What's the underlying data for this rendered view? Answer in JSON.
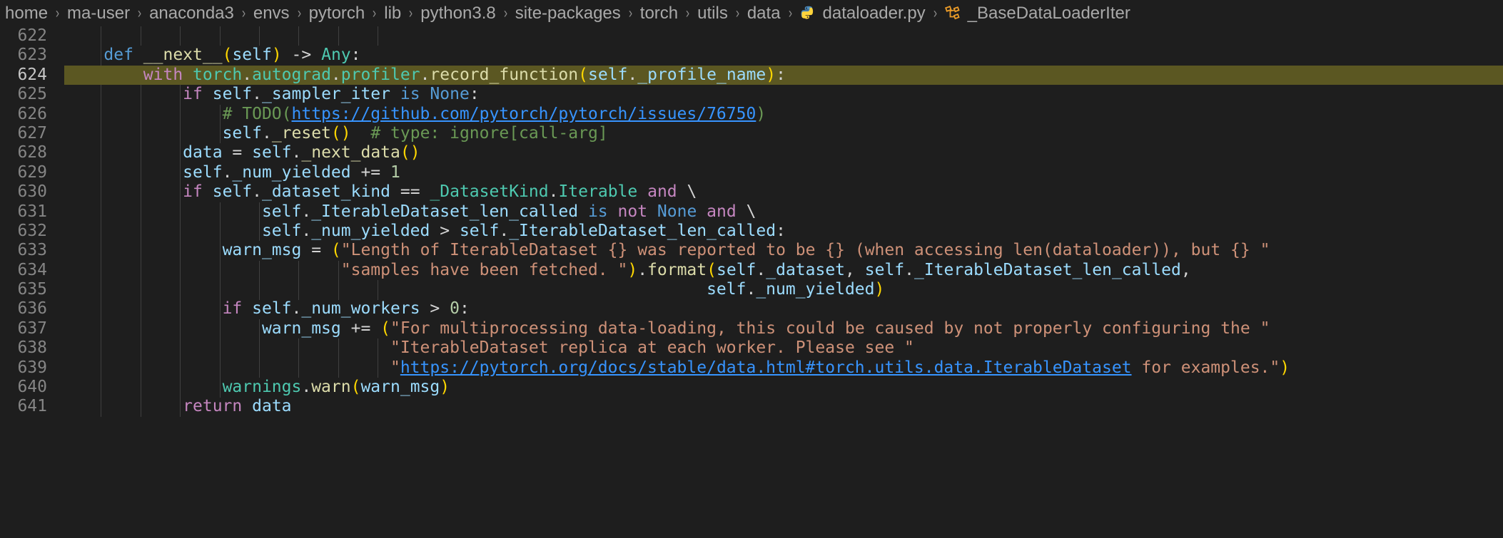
{
  "breadcrumb": {
    "separator": "›",
    "items": [
      {
        "label": "home",
        "icon": null
      },
      {
        "label": "ma-user",
        "icon": null
      },
      {
        "label": "anaconda3",
        "icon": null
      },
      {
        "label": "envs",
        "icon": null
      },
      {
        "label": "pytorch",
        "icon": null
      },
      {
        "label": "lib",
        "icon": null
      },
      {
        "label": "python3.8",
        "icon": null
      },
      {
        "label": "site-packages",
        "icon": null
      },
      {
        "label": "torch",
        "icon": null
      },
      {
        "label": "utils",
        "icon": null
      },
      {
        "label": "data",
        "icon": null
      },
      {
        "label": "dataloader.py",
        "icon": "python-file-icon"
      },
      {
        "label": "_BaseDataLoaderIter",
        "icon": "class-symbol-icon"
      }
    ]
  },
  "editor": {
    "highlighted_line": 624,
    "first_line": 622,
    "last_line": 641,
    "colors": {
      "background": "#1e1e1e",
      "highlight": "#5b5722",
      "line_number": "#858585",
      "keyword": "#c586c0",
      "keyword_blue": "#569cd6",
      "function": "#dcdcaa",
      "variable": "#9cdcfe",
      "class": "#4ec9b0",
      "string": "#ce9178",
      "comment": "#6a9955",
      "link": "#3794ff",
      "bracket1": "#ffd700",
      "bracket2": "#da70d6",
      "bracket3": "#179fff"
    },
    "lines": [
      {
        "n": 622,
        "text": ""
      },
      {
        "n": 623,
        "text": "    def __next__(self) -> Any:"
      },
      {
        "n": 624,
        "text": "        with torch.autograd.profiler.record_function(self._profile_name):"
      },
      {
        "n": 625,
        "text": "            if self._sampler_iter is None:"
      },
      {
        "n": 626,
        "text": "                # TODO(https://github.com/pytorch/pytorch/issues/76750)"
      },
      {
        "n": 627,
        "text": "                self._reset()  # type: ignore[call-arg]"
      },
      {
        "n": 628,
        "text": "            data = self._next_data()"
      },
      {
        "n": 629,
        "text": "            self._num_yielded += 1"
      },
      {
        "n": 630,
        "text": "            if self._dataset_kind == _DatasetKind.Iterable and \\"
      },
      {
        "n": 631,
        "text": "                    self._IterableDataset_len_called is not None and \\"
      },
      {
        "n": 632,
        "text": "                    self._num_yielded > self._IterableDataset_len_called:"
      },
      {
        "n": 633,
        "text": "                warn_msg = (\"Length of IterableDataset {} was reported to be {} (when accessing len(dataloader)), but {} \""
      },
      {
        "n": 634,
        "text": "                            \"samples have been fetched. \").format(self._dataset, self._IterableDataset_len_called,"
      },
      {
        "n": 635,
        "text": "                                                                 self._num_yielded)"
      },
      {
        "n": 636,
        "text": "                if self._num_workers > 0:"
      },
      {
        "n": 637,
        "text": "                    warn_msg += (\"For multiprocessing data-loading, this could be caused by not properly configuring the \""
      },
      {
        "n": 638,
        "text": "                                 \"IterableDataset replica at each worker. Please see \""
      },
      {
        "n": 639,
        "text": "                                 \"https://pytorch.org/docs/stable/data.html#torch.utils.data.IterableDataset for examples.\")"
      },
      {
        "n": 640,
        "text": "                warnings.warn(warn_msg)"
      },
      {
        "n": 641,
        "text": "            return data"
      }
    ]
  }
}
